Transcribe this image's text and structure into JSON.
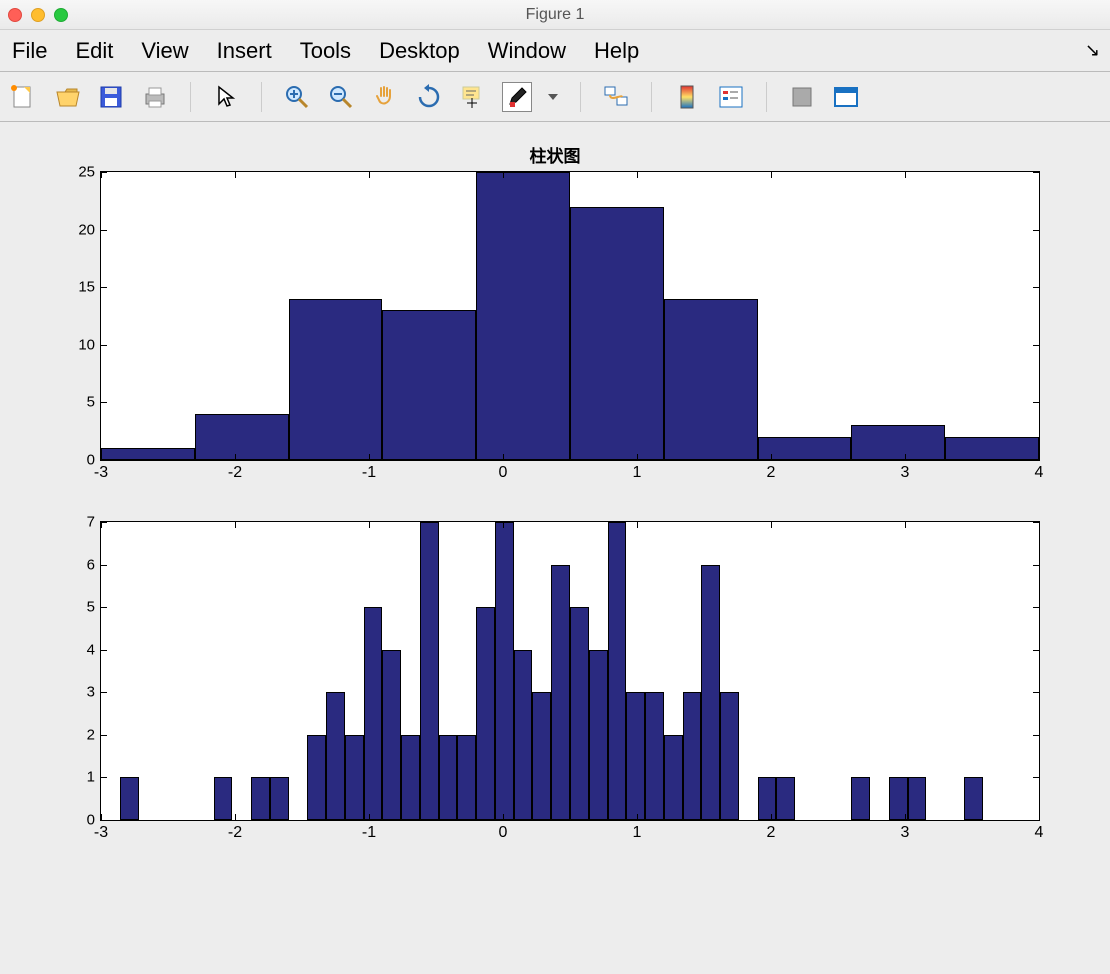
{
  "window": {
    "title": "Figure 1"
  },
  "menubar": [
    "File",
    "Edit",
    "View",
    "Insert",
    "Tools",
    "Desktop",
    "Window",
    "Help"
  ],
  "toolbar_icons": [
    "new-figure-icon",
    "open-icon",
    "save-icon",
    "print-icon",
    "pointer-icon",
    "zoom-in-icon",
    "zoom-out-icon",
    "pan-icon",
    "rotate-icon",
    "data-cursor-icon",
    "brush-icon",
    "dropdown-icon",
    "link-icon",
    "colorbar-icon",
    "legend-icon",
    "hide-icon",
    "dock-icon"
  ],
  "chart_data": [
    {
      "type": "bar",
      "title": "柱状图",
      "xlim": [
        -3,
        4
      ],
      "ylim": [
        0,
        25
      ],
      "xticks": [
        -3,
        -2,
        -1,
        0,
        1,
        2,
        3,
        4
      ],
      "yticks": [
        0,
        5,
        10,
        15,
        20,
        25
      ],
      "bin_width": 0.7,
      "bars": [
        {
          "x_left": -3.0,
          "value": 1
        },
        {
          "x_left": -2.3,
          "value": 4
        },
        {
          "x_left": -1.6,
          "value": 14
        },
        {
          "x_left": -0.9,
          "value": 13
        },
        {
          "x_left": -0.2,
          "value": 25
        },
        {
          "x_left": 0.5,
          "value": 22
        },
        {
          "x_left": 1.2,
          "value": 14
        },
        {
          "x_left": 1.9,
          "value": 2
        },
        {
          "x_left": 2.6,
          "value": 3
        },
        {
          "x_left": 3.3,
          "value": 2
        }
      ]
    },
    {
      "type": "bar",
      "title": "",
      "xlim": [
        -3,
        4
      ],
      "ylim": [
        0,
        7
      ],
      "xticks": [
        -3,
        -2,
        -1,
        0,
        1,
        2,
        3,
        4
      ],
      "yticks": [
        0,
        1,
        2,
        3,
        4,
        5,
        6,
        7
      ],
      "bin_width": 0.14,
      "bars": [
        {
          "x_left": -2.86,
          "value": 1
        },
        {
          "x_left": -2.16,
          "value": 1
        },
        {
          "x_left": -1.88,
          "value": 1
        },
        {
          "x_left": -1.74,
          "value": 1
        },
        {
          "x_left": -1.46,
          "value": 2
        },
        {
          "x_left": -1.32,
          "value": 3
        },
        {
          "x_left": -1.18,
          "value": 2
        },
        {
          "x_left": -1.04,
          "value": 5
        },
        {
          "x_left": -0.9,
          "value": 4
        },
        {
          "x_left": -0.76,
          "value": 2
        },
        {
          "x_left": -0.62,
          "value": 7
        },
        {
          "x_left": -0.48,
          "value": 2
        },
        {
          "x_left": -0.34,
          "value": 2
        },
        {
          "x_left": -0.2,
          "value": 5
        },
        {
          "x_left": -0.06,
          "value": 7
        },
        {
          "x_left": 0.08,
          "value": 4
        },
        {
          "x_left": 0.22,
          "value": 3
        },
        {
          "x_left": 0.36,
          "value": 6
        },
        {
          "x_left": 0.5,
          "value": 5
        },
        {
          "x_left": 0.64,
          "value": 4
        },
        {
          "x_left": 0.78,
          "value": 7
        },
        {
          "x_left": 0.92,
          "value": 3
        },
        {
          "x_left": 1.06,
          "value": 3
        },
        {
          "x_left": 1.2,
          "value": 2
        },
        {
          "x_left": 1.34,
          "value": 3
        },
        {
          "x_left": 1.48,
          "value": 6
        },
        {
          "x_left": 1.62,
          "value": 3
        },
        {
          "x_left": 1.9,
          "value": 1
        },
        {
          "x_left": 2.04,
          "value": 1
        },
        {
          "x_left": 2.6,
          "value": 1
        },
        {
          "x_left": 2.88,
          "value": 1
        },
        {
          "x_left": 3.02,
          "value": 1
        },
        {
          "x_left": 3.44,
          "value": 1
        }
      ]
    }
  ]
}
